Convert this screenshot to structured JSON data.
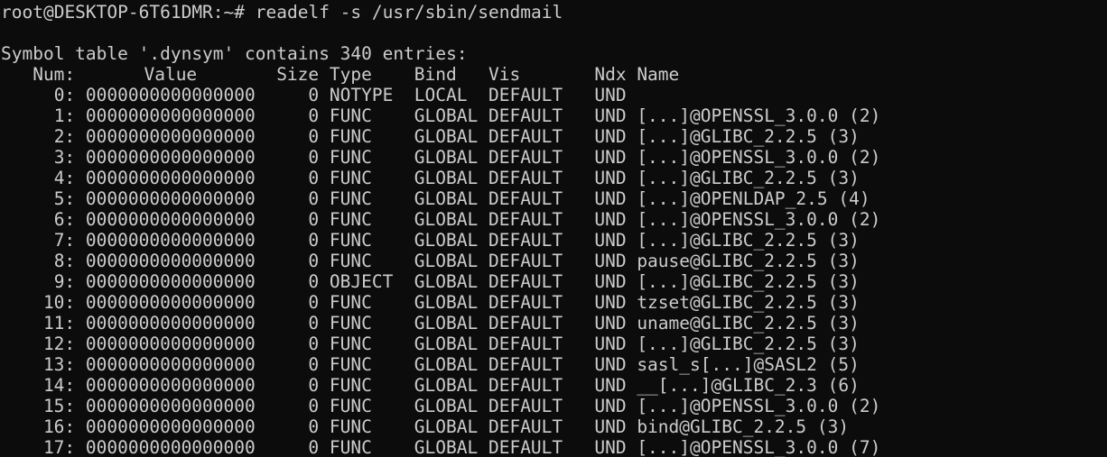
{
  "prompt": {
    "text": "root@DESKTOP-6T61DMR:~# ",
    "command": "readelf -s /usr/sbin/sendmail"
  },
  "summary": "Symbol table '.dynsym' contains 340 entries:",
  "header": {
    "num": "Num:",
    "value": "Value",
    "size": "Size",
    "type": "Type",
    "bind": "Bind",
    "vis": "Vis",
    "ndx": "Ndx",
    "name": "Name"
  },
  "rows": [
    {
      "num": "0:",
      "value": "0000000000000000",
      "size": "0",
      "type": "NOTYPE",
      "bind": "LOCAL",
      "vis": "DEFAULT",
      "ndx": "UND",
      "name": ""
    },
    {
      "num": "1:",
      "value": "0000000000000000",
      "size": "0",
      "type": "FUNC",
      "bind": "GLOBAL",
      "vis": "DEFAULT",
      "ndx": "UND",
      "name": "[...]@OPENSSL_3.0.0 (2)"
    },
    {
      "num": "2:",
      "value": "0000000000000000",
      "size": "0",
      "type": "FUNC",
      "bind": "GLOBAL",
      "vis": "DEFAULT",
      "ndx": "UND",
      "name": "[...]@GLIBC_2.2.5 (3)"
    },
    {
      "num": "3:",
      "value": "0000000000000000",
      "size": "0",
      "type": "FUNC",
      "bind": "GLOBAL",
      "vis": "DEFAULT",
      "ndx": "UND",
      "name": "[...]@OPENSSL_3.0.0 (2)"
    },
    {
      "num": "4:",
      "value": "0000000000000000",
      "size": "0",
      "type": "FUNC",
      "bind": "GLOBAL",
      "vis": "DEFAULT",
      "ndx": "UND",
      "name": "[...]@GLIBC_2.2.5 (3)"
    },
    {
      "num": "5:",
      "value": "0000000000000000",
      "size": "0",
      "type": "FUNC",
      "bind": "GLOBAL",
      "vis": "DEFAULT",
      "ndx": "UND",
      "name": "[...]@OPENLDAP_2.5 (4)"
    },
    {
      "num": "6:",
      "value": "0000000000000000",
      "size": "0",
      "type": "FUNC",
      "bind": "GLOBAL",
      "vis": "DEFAULT",
      "ndx": "UND",
      "name": "[...]@OPENSSL_3.0.0 (2)"
    },
    {
      "num": "7:",
      "value": "0000000000000000",
      "size": "0",
      "type": "FUNC",
      "bind": "GLOBAL",
      "vis": "DEFAULT",
      "ndx": "UND",
      "name": "[...]@GLIBC_2.2.5 (3)"
    },
    {
      "num": "8:",
      "value": "0000000000000000",
      "size": "0",
      "type": "FUNC",
      "bind": "GLOBAL",
      "vis": "DEFAULT",
      "ndx": "UND",
      "name": "pause@GLIBC_2.2.5 (3)"
    },
    {
      "num": "9:",
      "value": "0000000000000000",
      "size": "0",
      "type": "OBJECT",
      "bind": "GLOBAL",
      "vis": "DEFAULT",
      "ndx": "UND",
      "name": "[...]@GLIBC_2.2.5 (3)"
    },
    {
      "num": "10:",
      "value": "0000000000000000",
      "size": "0",
      "type": "FUNC",
      "bind": "GLOBAL",
      "vis": "DEFAULT",
      "ndx": "UND",
      "name": "tzset@GLIBC_2.2.5 (3)"
    },
    {
      "num": "11:",
      "value": "0000000000000000",
      "size": "0",
      "type": "FUNC",
      "bind": "GLOBAL",
      "vis": "DEFAULT",
      "ndx": "UND",
      "name": "uname@GLIBC_2.2.5 (3)"
    },
    {
      "num": "12:",
      "value": "0000000000000000",
      "size": "0",
      "type": "FUNC",
      "bind": "GLOBAL",
      "vis": "DEFAULT",
      "ndx": "UND",
      "name": "[...]@GLIBC_2.2.5 (3)"
    },
    {
      "num": "13:",
      "value": "0000000000000000",
      "size": "0",
      "type": "FUNC",
      "bind": "GLOBAL",
      "vis": "DEFAULT",
      "ndx": "UND",
      "name": "sasl_s[...]@SASL2 (5)"
    },
    {
      "num": "14:",
      "value": "0000000000000000",
      "size": "0",
      "type": "FUNC",
      "bind": "GLOBAL",
      "vis": "DEFAULT",
      "ndx": "UND",
      "name": "__[...]@GLIBC_2.3 (6)"
    },
    {
      "num": "15:",
      "value": "0000000000000000",
      "size": "0",
      "type": "FUNC",
      "bind": "GLOBAL",
      "vis": "DEFAULT",
      "ndx": "UND",
      "name": "[...]@OPENSSL_3.0.0 (2)"
    },
    {
      "num": "16:",
      "value": "0000000000000000",
      "size": "0",
      "type": "FUNC",
      "bind": "GLOBAL",
      "vis": "DEFAULT",
      "ndx": "UND",
      "name": "bind@GLIBC_2.2.5 (3)"
    },
    {
      "num": "17:",
      "value": "0000000000000000",
      "size": "0",
      "type": "FUNC",
      "bind": "GLOBAL",
      "vis": "DEFAULT",
      "ndx": "UND",
      "name": "[...]@OPENSSL_3.0.0 (7)"
    }
  ],
  "colors": {
    "background": "#0c0c0c",
    "foreground": "#cccccc"
  }
}
